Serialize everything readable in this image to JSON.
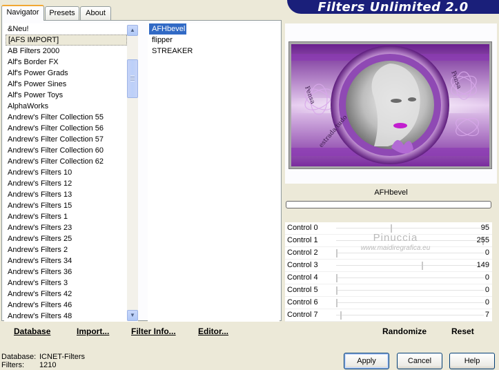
{
  "banner": {
    "title": "Filters Unlimited 2.0"
  },
  "tabs": [
    {
      "label": "Navigator",
      "active": true
    },
    {
      "label": "Presets",
      "active": false
    },
    {
      "label": "About",
      "active": false
    }
  ],
  "categories": [
    "&Neu!",
    "[AFS IMPORT]",
    "AB Filters 2000",
    "Alf's Border FX",
    "Alf's Power Grads",
    "Alf's Power Sines",
    "Alf's Power Toys",
    "AlphaWorks",
    "Andrew's Filter Collection 55",
    "Andrew's Filter Collection 56",
    "Andrew's Filter Collection 57",
    "Andrew's Filter Collection 60",
    "Andrew's Filter Collection 62",
    "Andrew's Filters 10",
    "Andrew's Filters 12",
    "Andrew's Filters 13",
    "Andrew's Filters 15",
    "Andrew's Filters 1",
    "Andrew's Filters 23",
    "Andrew's Filters 25",
    "Andrew's Filters 2",
    "Andrew's Filters 34",
    "Andrew's Filters 36",
    "Andrew's Filters 3",
    "Andrew's Filters 42",
    "Andrew's Filters 46",
    "Andrew's Filters 48"
  ],
  "selected_category": "[AFS IMPORT]",
  "filters": [
    "AFHbevel",
    "flipper",
    "STREAKER"
  ],
  "selected_filter": "AFHbevel",
  "left_buttons": {
    "database": "Database",
    "import": "Import...",
    "filter_info": "Filter Info...",
    "editor": "Editor..."
  },
  "preview": {
    "filter_name": "AFHbevel",
    "progress": 0,
    "image_text": {
      "left_arc": "Pensa",
      "right_arc": "Pensa",
      "bottom_arc": "estrada tudo"
    }
  },
  "controls": [
    {
      "label": "Control 0",
      "value": "95"
    },
    {
      "label": "Control 1",
      "value": "255"
    },
    {
      "label": "Control 2",
      "value": "0"
    },
    {
      "label": "Control 3",
      "value": "149"
    },
    {
      "label": "Control 4",
      "value": "0"
    },
    {
      "label": "Control 5",
      "value": "0"
    },
    {
      "label": "Control 6",
      "value": "0"
    },
    {
      "label": "Control 7",
      "value": "7"
    }
  ],
  "watermark": {
    "name": "Pinuccia",
    "url": "www.maidiregrafica.eu"
  },
  "right_buttons": {
    "randomize": "Randomize",
    "reset": "Reset"
  },
  "status": {
    "database_label": "Database:",
    "database_value": "ICNET-Filters",
    "filters_label": "Filters:",
    "filters_value": "1210"
  },
  "dialog_buttons": {
    "apply": "Apply",
    "cancel": "Cancel",
    "help": "Help"
  },
  "colors": {
    "banner": "#1a1f7a",
    "selection": "#316ac5",
    "accent_purple": "#a23ec9"
  },
  "icons": {
    "scroll_up": "▲",
    "scroll_down": "▼"
  }
}
